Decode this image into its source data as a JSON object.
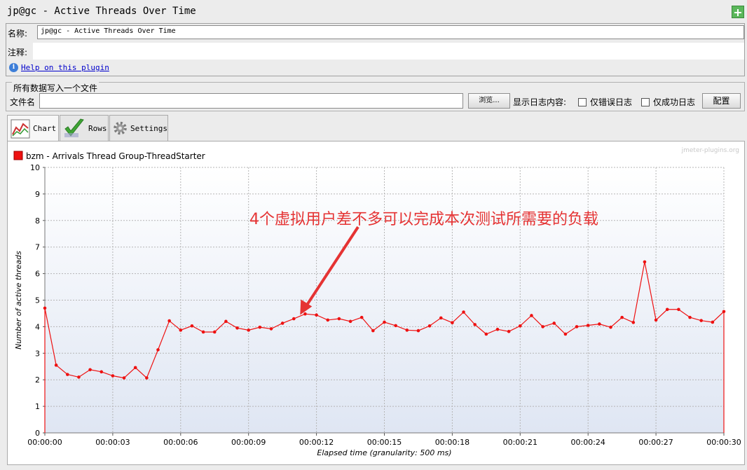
{
  "window": {
    "title": "jp@gc - Active Threads Over Time"
  },
  "form": {
    "name_label": "名称:",
    "name_value": "jp@gc - Active Threads Over Time",
    "comment_label": "注释:",
    "comment_value": "",
    "help_link": "Help on this plugin"
  },
  "file_section": {
    "legend": "所有数据写入一个文件",
    "filename_label": "文件名",
    "filename_value": "",
    "browse_button": "浏览...",
    "log_label": "显示日志内容:",
    "errors_only": "仅错误日志",
    "success_only": "仅成功日志",
    "configure_button": "配置"
  },
  "tabs": [
    {
      "label": "Chart",
      "icon": "chart-icon"
    },
    {
      "label": "Rows",
      "icon": "checkmark-icon"
    },
    {
      "label": "Settings",
      "icon": "gear-icon"
    }
  ],
  "chart_data": {
    "type": "line",
    "watermark": "jmeter-plugins.org",
    "legend_placement": "top-left",
    "series": [
      {
        "name": "bzm - Arrivals Thread Group-ThreadStarter",
        "color": "#ee1111",
        "x": [
          0,
          0.5,
          1,
          1.5,
          2,
          2.5,
          3,
          3.5,
          4,
          4.5,
          5,
          5.5,
          6,
          6.5,
          7,
          7.5,
          8,
          8.5,
          9,
          9.5,
          10,
          10.5,
          11,
          11.5,
          12,
          12.5,
          13,
          13.5,
          14,
          14.5,
          15,
          15.5,
          16,
          16.5,
          17,
          17.5,
          18,
          18.5,
          19,
          19.5,
          20,
          20.5,
          21,
          21.5,
          22,
          22.5,
          23,
          23.5,
          24,
          24.5,
          25,
          25.5,
          26,
          26.5,
          27,
          27.5,
          28,
          28.5,
          29,
          29.5,
          30
        ],
        "y": [
          4.7,
          2.55,
          2.2,
          2.1,
          2.38,
          2.3,
          2.15,
          2.07,
          2.46,
          2.07,
          3.13,
          4.22,
          3.87,
          4.03,
          3.8,
          3.8,
          4.2,
          3.95,
          3.87,
          3.98,
          3.92,
          4.13,
          4.3,
          4.48,
          4.44,
          4.25,
          4.3,
          4.2,
          4.35,
          3.85,
          4.17,
          4.04,
          3.87,
          3.85,
          4.03,
          4.33,
          4.15,
          4.55,
          4.08,
          3.72,
          3.9,
          3.82,
          4.03,
          4.42,
          4.0,
          4.13,
          3.72,
          4.0,
          4.05,
          4.1,
          3.98,
          4.35,
          4.16,
          6.44,
          4.25,
          4.65,
          4.65,
          4.35,
          4.23,
          4.17,
          4.57
        ]
      }
    ],
    "xlabel": "Elapsed time (granularity: 500 ms)",
    "ylabel": "Number of active threads",
    "xlim": [
      0,
      30
    ],
    "ylim": [
      0,
      10
    ],
    "x_ticks": [
      "00:00:00",
      "00:00:03",
      "00:00:06",
      "00:00:09",
      "00:00:12",
      "00:00:15",
      "00:00:18",
      "00:00:21",
      "00:00:24",
      "00:00:27",
      "00:00:30"
    ],
    "y_ticks": [
      0,
      1,
      2,
      3,
      4,
      5,
      6,
      7,
      8,
      9,
      10
    ],
    "grid": true,
    "annotation": {
      "text": "4个虚拟用户差不多可以完成本次测试所需要的负载",
      "color": "#e53333",
      "points_to": {
        "x": 11,
        "y": 4.5
      }
    }
  }
}
